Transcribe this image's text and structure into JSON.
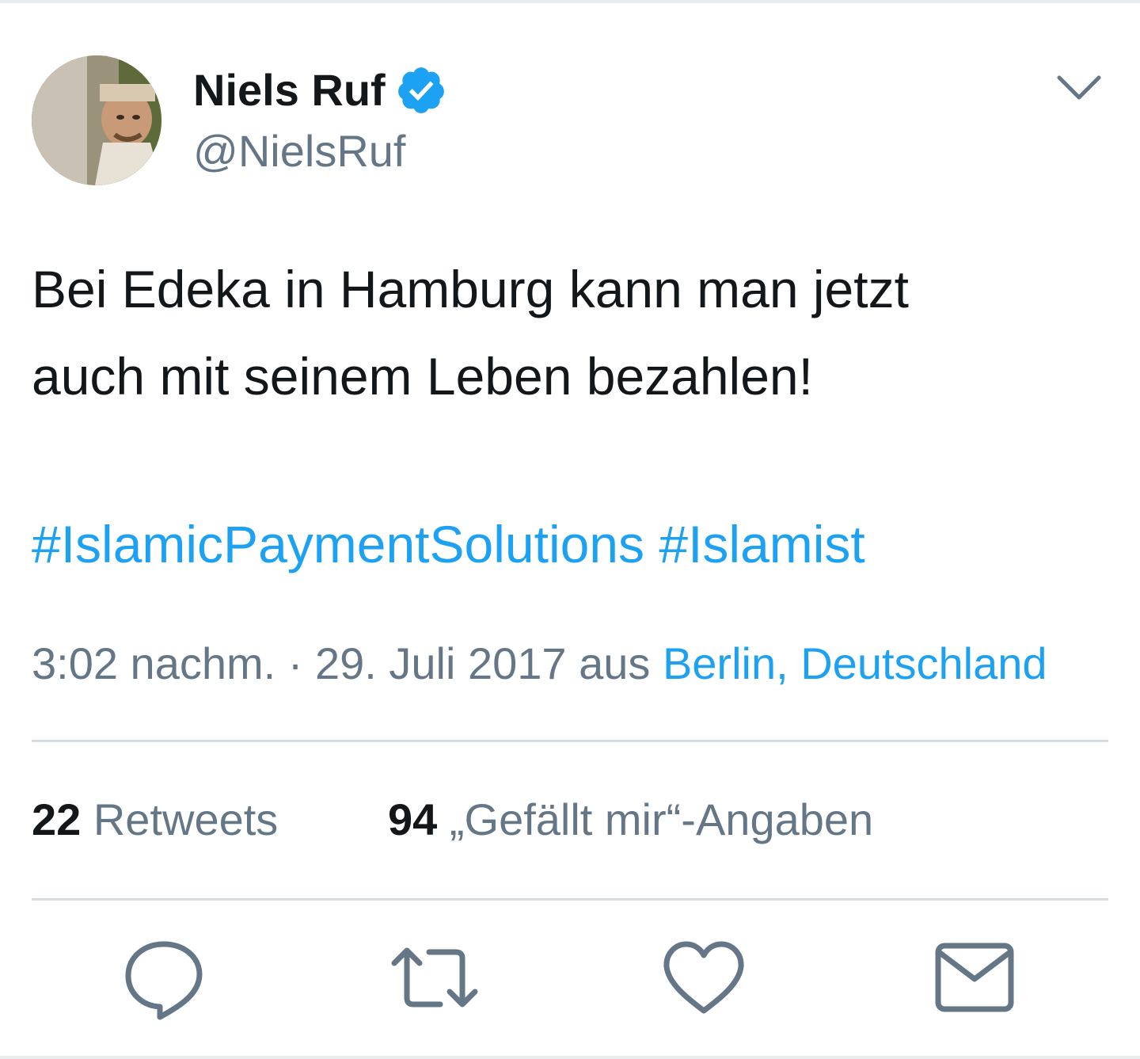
{
  "header": {
    "display_name": "Niels Ruf",
    "handle": "@NielsRuf",
    "verified": true
  },
  "tweet": {
    "text_lines": [
      "Bei Edeka in Hamburg kann man jetzt",
      "auch mit seinem Leben bezahlen!"
    ],
    "hashtags": [
      "#IslamicPaymentSolutions",
      "#Islamist"
    ]
  },
  "meta": {
    "timestamp": "3:02 nachm. · 29. Juli 2017 aus ",
    "location": "Berlin, Deutschland"
  },
  "stats": {
    "retweets_count": "22",
    "retweets_label": " Retweets",
    "likes_count": "94",
    "likes_label": " „Gefällt mir“-Angaben"
  },
  "actions": [
    {
      "icon": "reply-icon"
    },
    {
      "icon": "retweet-icon"
    },
    {
      "icon": "like-icon"
    },
    {
      "icon": "direct-message-icon"
    }
  ],
  "colors": {
    "accent": "#1da1f2",
    "secondary_text": "#657786",
    "primary_text": "#14171a",
    "icon_gray": "#657786",
    "divider": "#d7dde2"
  }
}
